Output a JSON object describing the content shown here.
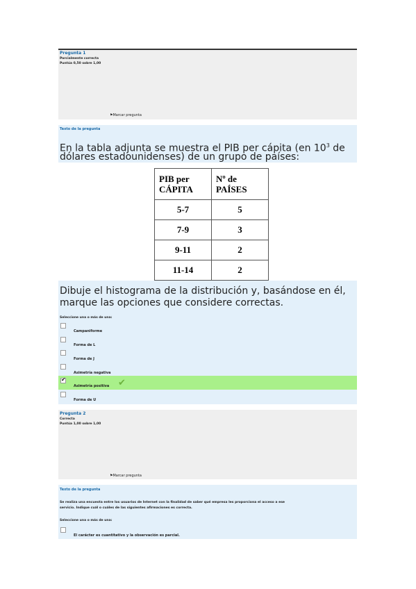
{
  "q1": {
    "number_label": "Pregunta 1",
    "status": "Parcialmente correcta",
    "score": "Puntúa 0,50 sobre 1,00",
    "flag_label": "Marcar pregunta",
    "text_heading": "Texto de la pregunta",
    "intro_line1_pre": "En la tabla adjunta se muestra el PIB per cápita (en 10",
    "intro_sup": "3",
    "intro_line1_post": " de",
    "intro_line2": "dólares estadounidenses) de un grupo de países:",
    "table": {
      "header_col1_line1": "PIB per",
      "header_col1_line2": "CÁPITA",
      "header_col2_line1": "Nº de",
      "header_col2_line2": "PAÍSES",
      "rows": [
        {
          "range": "5-7",
          "count": "5"
        },
        {
          "range": "7-9",
          "count": "3"
        },
        {
          "range": "9-11",
          "count": "2"
        },
        {
          "range": "11-14",
          "count": "2"
        }
      ]
    },
    "instruction_line1": "Dibuje el histograma de la distribución y, basándose en él,",
    "instruction_line2": "marque las opciones que considere correctas.",
    "select_label": "Seleccione una o más de una:",
    "options": [
      {
        "label": "Campaniforme",
        "checked": false
      },
      {
        "label": "Forma de L",
        "checked": false
      },
      {
        "label": "Forma de J",
        "checked": false
      },
      {
        "label": "Asimetría negativa",
        "checked": false
      },
      {
        "label": "Asimetría positiva",
        "checked": true,
        "correct": true
      },
      {
        "label": "Forma de U",
        "checked": false
      }
    ],
    "correct_color": "#a9f08a"
  },
  "q2": {
    "number_label": "Pregunta 2",
    "status": "Correcta",
    "score": "Puntúa 1,00 sobre 1,00",
    "flag_label": "Marcar pregunta",
    "text_heading": "Texto de la pregunta",
    "body_line1": "Se realiza una encuesta entre los usuarios de Internet con la finalidad de saber qué empresa les proporciona el acceso a ese",
    "body_line2": "servicio. Indique cuál o cuáles de las siguientes afirmaciones es correcta.",
    "select_label": "Seleccione una o más de una:",
    "options": [
      {
        "label": "El carácter es cuantitativo y la observación es parcial.",
        "checked": false
      }
    ]
  }
}
